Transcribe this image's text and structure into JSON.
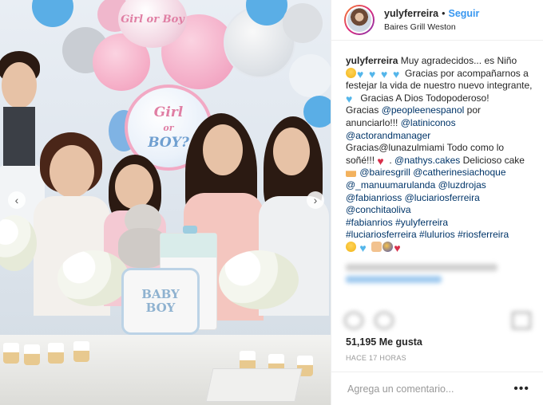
{
  "post": {
    "username": "yulyferreira",
    "separator": "•",
    "follow_label": "Seguir",
    "location": "Baires Grill Weston",
    "caption": {
      "p1": "Muy agradecidos... es Niño",
      "p2": "Gracias por acompañarnos a festejar la vida de nuestro nuevo integrante,",
      "p3": "Gracias A Dios Todopoderoso!",
      "p4a": "Gracias",
      "m_people": "@peopleenespanol",
      "p4b": "por anunciarlo!!!",
      "m_latinicons": "@latiniconos",
      "m_actorandmanager": "@actorandmanager",
      "p5": "Gracias@lunazulmiami Todo como lo soñé!!!",
      "m_nathys": "@nathys.cakes",
      "p6": "Delicioso cake",
      "m_bairesgrill": "@bairesgrill",
      "m_catherine": "@catherinesiachoque",
      "m_manuu": "@_manuumarulanda",
      "m_luzd": "@luzdrojas",
      "m_fabian": "@fabianrioss",
      "m_luciario": "@luciariosferreira",
      "m_conchita": "@conchitaoliva",
      "h1": "#fabianrios",
      "h2": "#yulyferreira",
      "h3": "#luciariosferreira",
      "h4": "#lulurios",
      "h5": "#riosferreira"
    },
    "likes_text": "51,195 Me gusta",
    "time_text": "HACE 17 HORAS",
    "comment_placeholder": "Agrega un comentario...",
    "more_icon": "•••"
  },
  "photo": {
    "balloon_main_text_1": "Girl",
    "balloon_main_text_2": "or",
    "balloon_main_text_3": "BOY?",
    "balloon_top_text": "Girl or Boy",
    "sign_text_1": "BABY",
    "sign_text_2": "BOY",
    "arrow_left": "‹",
    "arrow_right": "›"
  },
  "colors": {
    "accent_link": "#3897f0",
    "mention": "#003569",
    "balloon_pink": "#f2a9c4",
    "balloon_blue": "#8fb2d0"
  }
}
